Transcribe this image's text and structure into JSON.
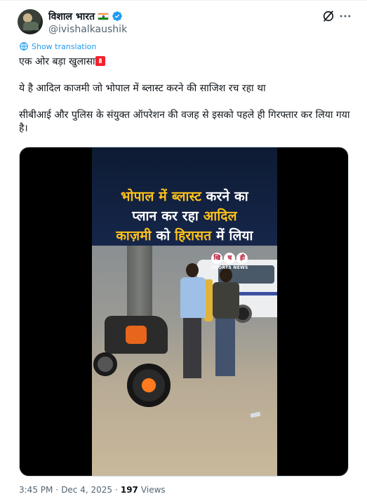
{
  "author": {
    "display_name": "विशाल भारत",
    "handle": "@ivishalkaushik",
    "verified_color": "#1d9bf0"
  },
  "actions": {
    "grok_icon": "grok-icon",
    "more_icon": "more-horizontal-icon"
  },
  "translate_label": "Show translation",
  "tweet": {
    "line1": "एक ओर बड़ा खुलासा",
    "line2": "ये है आदिल काजमी जो भोपाल में ब्लास्ट करने की साजिश रच रहा था",
    "line3": "सीबीआई और पुलिस के संयुक्त ऑपरेशन की वजह से इसको पहले ही गिरफ्तार कर लिया गया है।"
  },
  "video": {
    "title_l1a": "भोपाल में ",
    "title_l1b": "ब्लास्ट",
    "title_l1c": " करने का",
    "title_l2a": "प्लान कर रहा ",
    "title_l2b": "आदिल",
    "title_l3a": "काज़मी",
    "title_l3b": " को ",
    "title_l3c": "हिरासत",
    "title_l3d": " में लिया",
    "watermark_c1": "खि",
    "watermark_c2": "च",
    "watermark_c3": "ड़ी",
    "watermark_text": "SHORTS NEWS"
  },
  "meta": {
    "time": "3:45 PM",
    "separator": "·",
    "date": "Dec 4, 2025",
    "views_count": "197",
    "views_label": "Views"
  },
  "colors": {
    "link": "#1d9bf0",
    "text": "#0f1419",
    "secondary": "#536471",
    "headline_yellow": "#ffc21a"
  }
}
